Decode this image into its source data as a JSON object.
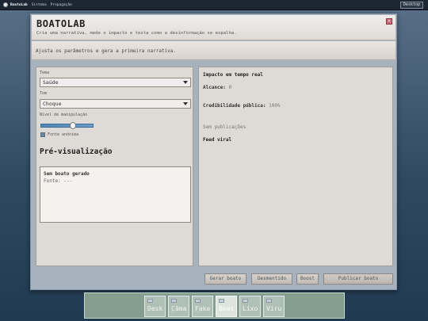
{
  "system_bar": {
    "brand": "BoatoLab",
    "menu": [
      "Sistema",
      "Propagação"
    ],
    "desktop_button": "Desktop"
  },
  "window": {
    "title": "BOATOLAB",
    "subtitle": "Cria uma narrativa, mede o impacto e testa como a desinformação se espalha.",
    "close_label": "×",
    "notice": "Ajusta os parâmetros e gera a primeira narrativa."
  },
  "controls": {
    "theme_label": "Tema",
    "theme_value": "Saúde",
    "tone_label": "Tom",
    "tone_value": "Choque",
    "manipulation_label": "Nível de manipulação",
    "manipulation_level": 0.6,
    "anonymous_source_label": "Fonte anónima",
    "anonymous_source_checked": true
  },
  "preview": {
    "heading": "Pré-visualização",
    "title": "Sem boato gerado",
    "source": "Fonte: ---"
  },
  "impact": {
    "title": "Impacto em tempo real",
    "reach_label": "Alcance:",
    "reach_value": "0",
    "credibility_label": "Credibilidade pública:",
    "credibility_value": "100%",
    "no_posts": "Sem publicações",
    "feed_title": "Feed viral"
  },
  "actions": {
    "generate": "Gerar boato",
    "debunk": "Desmentido",
    "boost": "Boost",
    "publish": "Publicar boato"
  },
  "dock": {
    "items": [
      {
        "label": "Desk",
        "active": false,
        "dash": ""
      },
      {
        "label": "Câma",
        "active": false,
        "dash": "—"
      },
      {
        "label": "Fake",
        "active": false,
        "dash": "--"
      },
      {
        "label": "Boat",
        "active": true,
        "dash": ""
      },
      {
        "label": "Lixo",
        "active": false,
        "dash": ""
      },
      {
        "label": "Viru",
        "active": false,
        "dash": ""
      }
    ]
  },
  "colors": {
    "accent": "#5b8fc0",
    "close": "#c46a78"
  }
}
